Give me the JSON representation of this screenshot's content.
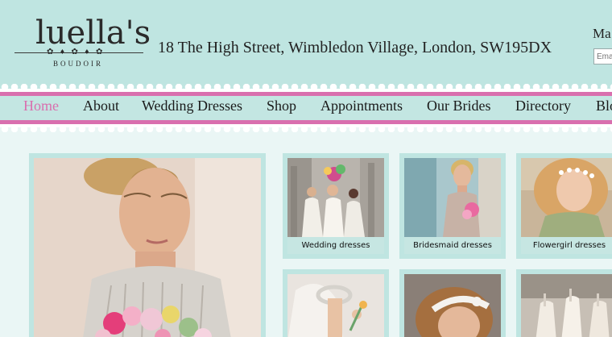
{
  "brand": {
    "name": "luella's",
    "subtitle": "BOUDOIR"
  },
  "header": {
    "address": "18 The High Street, Wimbledon Village, London, SW195DX",
    "mailing_label": "Ma",
    "email_placeholder": "Ema"
  },
  "nav": {
    "items": [
      {
        "label": "Home",
        "active": true
      },
      {
        "label": "About"
      },
      {
        "label": "Wedding Dresses"
      },
      {
        "label": "Shop"
      },
      {
        "label": "Appointments"
      },
      {
        "label": "Our Brides"
      },
      {
        "label": "Directory"
      },
      {
        "label": "Blo"
      }
    ]
  },
  "thumbnails": [
    {
      "caption": "Wedding dresses"
    },
    {
      "caption": "Bridesmaid dresses"
    },
    {
      "caption": "Flowergirl dresses"
    }
  ],
  "colors": {
    "header_bg": "#bfe5e1",
    "accent_pink": "#d96fae",
    "page_bg": "#eaf6f5"
  }
}
